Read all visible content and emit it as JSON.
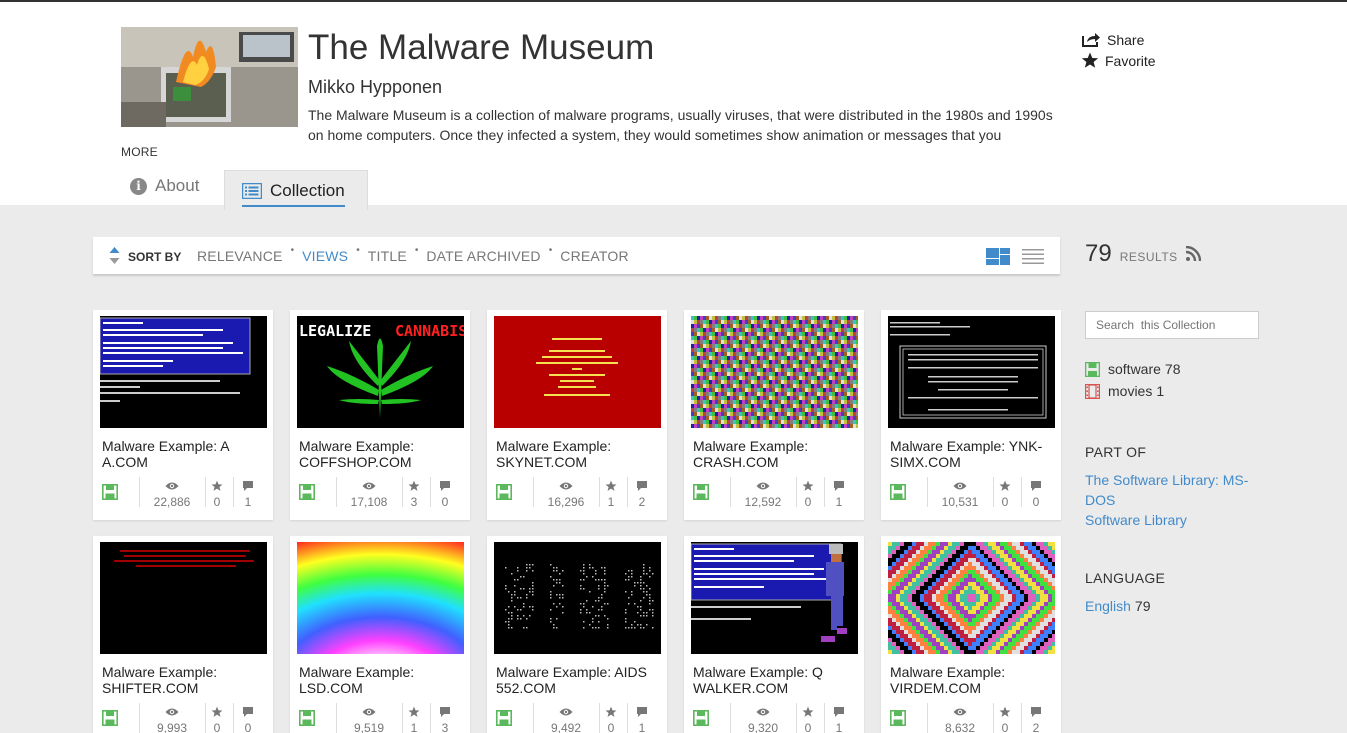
{
  "page": {
    "title": "The Malware Museum",
    "creator": "Mikko Hypponen",
    "description": "The Malware Museum is a collection of malware programs, usually viruses, that were distributed in the 1980s and 1990s on home computers. Once they infected a system, they would sometimes show animation or messages that you",
    "more_label": "MORE",
    "share_label": "Share",
    "favorite_label": "Favorite"
  },
  "tabs": [
    {
      "label": "About"
    },
    {
      "label": "Collection"
    }
  ],
  "sort": {
    "label": "SORT BY",
    "options": [
      "RELEVANCE",
      "VIEWS",
      "TITLE",
      "DATE ARCHIVED",
      "CREATOR"
    ],
    "active": "VIEWS"
  },
  "results": {
    "count": "79",
    "label": "RESULTS"
  },
  "search": {
    "placeholder": "Search  this Collection"
  },
  "facets": [
    {
      "label": "software",
      "count": "78",
      "color": "#5cb85c",
      "icon": "floppy-icon"
    },
    {
      "label": "movies",
      "count": "1",
      "color": "#d9534f",
      "icon": "film-icon"
    }
  ],
  "part_of": {
    "heading": "PART OF",
    "links": [
      "The Software Library: MS-DOS",
      "Software Library"
    ]
  },
  "language": {
    "heading": "LANGUAGE",
    "items": [
      {
        "label": "English",
        "count": "79"
      }
    ]
  },
  "items": [
    {
      "title": "Malware Example: A A.COM",
      "views": "22,886",
      "favs": "0",
      "reviews": "1"
    },
    {
      "title": "Malware Example: COFFSHOP.COM",
      "views": "17,108",
      "favs": "3",
      "reviews": "0"
    },
    {
      "title": "Malware Example: SKYNET.COM",
      "views": "16,296",
      "favs": "1",
      "reviews": "2"
    },
    {
      "title": "Malware Example: CRASH.COM",
      "views": "12,592",
      "favs": "0",
      "reviews": "1"
    },
    {
      "title": "Malware Example: YNK-SIMX.COM",
      "views": "10,531",
      "favs": "0",
      "reviews": "0"
    },
    {
      "title": "Malware Example: SHIFTER.COM",
      "views": "9,993",
      "favs": "0",
      "reviews": "0"
    },
    {
      "title": "Malware Example: LSD.COM",
      "views": "9,519",
      "favs": "1",
      "reviews": "3"
    },
    {
      "title": "Malware Example: AIDS 552.COM",
      "views": "9,492",
      "favs": "0",
      "reviews": "1"
    },
    {
      "title": "Malware Example: Q WALKER.COM",
      "views": "9,320",
      "favs": "0",
      "reviews": "1"
    },
    {
      "title": "Malware Example: VIRDEM.COM",
      "views": "8,632",
      "favs": "0",
      "reviews": "2"
    }
  ],
  "thumb_text": {
    "coffshop_left": "LEGALIZE",
    "coffshop_right": "CANNABIS"
  },
  "colors": {
    "accent": "#428bca",
    "software_green": "#5cb85c"
  }
}
